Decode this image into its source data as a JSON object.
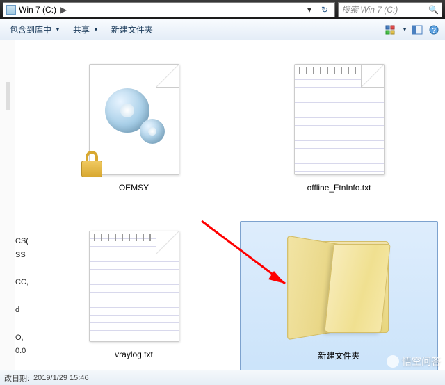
{
  "address": {
    "drive_label": "Win 7 (C:)",
    "arrow": "▶"
  },
  "search": {
    "placeholder": "搜索 Win 7 (C:)"
  },
  "toolbar": {
    "include": "包含到库中",
    "share": "共享",
    "newfolder": "新建文件夹"
  },
  "files": {
    "oemsy": "OEMSY",
    "offline": "offline_FtnInfo.txt",
    "vraylog": "vraylog.txt",
    "newfolder": "新建文件夹"
  },
  "left_fragments": [
    "CS(",
    "SS",
    "CC,",
    "d",
    "O,",
    "0.0"
  ],
  "status": {
    "date_label": "改日期:",
    "date_value": "2019/1/29 15:46"
  },
  "watermark": "悟空问答"
}
